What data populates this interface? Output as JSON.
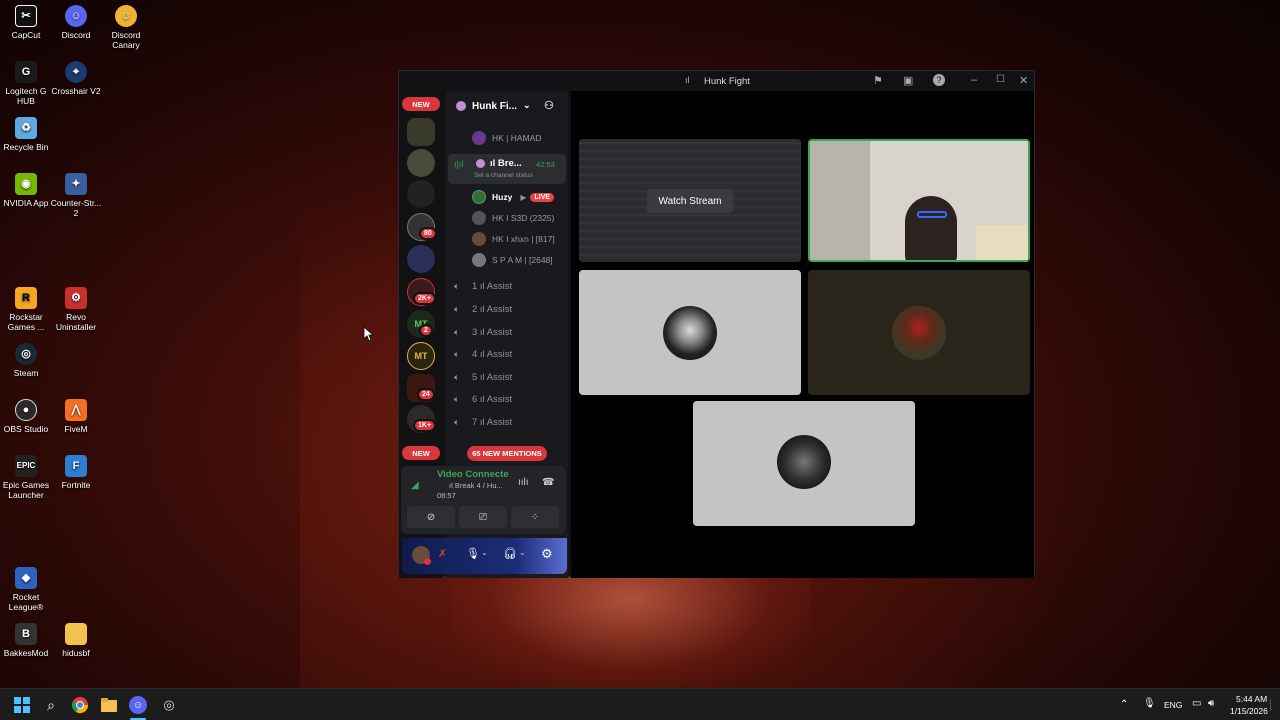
{
  "desktop": {
    "icons": [
      {
        "label": "CapCut",
        "icon": "capcut-icon",
        "color": "#111111"
      },
      {
        "label": "Discord",
        "icon": "discord-icon",
        "color": "#5865f2"
      },
      {
        "label": "Discord Canary",
        "icon": "discord-canary-icon",
        "color": "#f0b232"
      },
      {
        "label": "Logitech G HUB",
        "icon": "logitech-icon",
        "color": "#1a1a1a"
      },
      {
        "label": "Crosshair V2",
        "icon": "crosshair-icon",
        "color": "#1f3a70"
      },
      {
        "label": "Recycle Bin",
        "icon": "recycle-bin-icon",
        "color": "#5fa8e0"
      },
      {
        "label": "NVIDIA App",
        "icon": "nvidia-icon",
        "color": "#76b900"
      },
      {
        "label": "Counter-Str... 2",
        "icon": "counter-strike-icon",
        "color": "#3b5ea0"
      },
      {
        "label": "Rockstar Games ...",
        "icon": "rockstar-icon",
        "color": "#f5a623"
      },
      {
        "label": "Revo Uninstaller",
        "icon": "revo-icon",
        "color": "#c9302c"
      },
      {
        "label": "Steam",
        "icon": "steam-icon",
        "color": "#1b2838"
      },
      {
        "label": "OBS Studio",
        "icon": "obs-icon",
        "color": "#2a2a2a"
      },
      {
        "label": "FiveM",
        "icon": "fivem-icon",
        "color": "#f37021"
      },
      {
        "label": "Epic Games Launcher",
        "icon": "epic-games-icon",
        "color": "#222222"
      },
      {
        "label": "Fortnite",
        "icon": "fortnite-icon",
        "color": "#2d7dd2"
      },
      {
        "label": "Rocket League®",
        "icon": "rocket-league-icon",
        "color": "#2c64c0"
      },
      {
        "label": "BakkesMod",
        "icon": "bakkesmod-icon",
        "color": "#333333"
      },
      {
        "label": "hidusbf",
        "icon": "folder-icon",
        "color": "#f2c14e"
      }
    ]
  },
  "window": {
    "title": "Hunk Fight"
  },
  "guilds": {
    "new_label": "NEW",
    "badges": [
      "80",
      "2K+",
      "2",
      "24",
      "1K+"
    ],
    "mt_label": "MT"
  },
  "channels": {
    "server_name": "Hunk Fi...",
    "top_member": "HK | HAMAD",
    "active_channel": "ıl Bre...",
    "active_timer": "42:53",
    "channel_status": "Set a channel status",
    "members": [
      {
        "name": "Huzy",
        "live": "LIVE"
      },
      {
        "name": "HK I S3D (2325)"
      },
      {
        "name": "HK I xhxn | [817]"
      },
      {
        "name": "S P A M | [2648]"
      }
    ],
    "voice_channels": [
      "1 ıl Assist",
      "2 ıl Assist",
      "3 ıl Assist",
      "4 ıl Assist",
      "5 ıl Assist",
      "6 ıl Assist",
      "7 ıl Assist"
    ],
    "mentions_label": "65 NEW MENTIONS"
  },
  "voice_panel": {
    "status": "Video Connecte",
    "channel": "ıl Break 4 / Hu...",
    "timer": "08:57"
  },
  "stage": {
    "watch_stream": "Watch Stream"
  },
  "taskbar": {
    "language": "ENG",
    "time": "5:44 AM",
    "date": "1/15/2026"
  },
  "colors": {
    "discord_red": "#da373c",
    "speaking_green": "#3ba55c",
    "live_red": "#ed4245"
  }
}
